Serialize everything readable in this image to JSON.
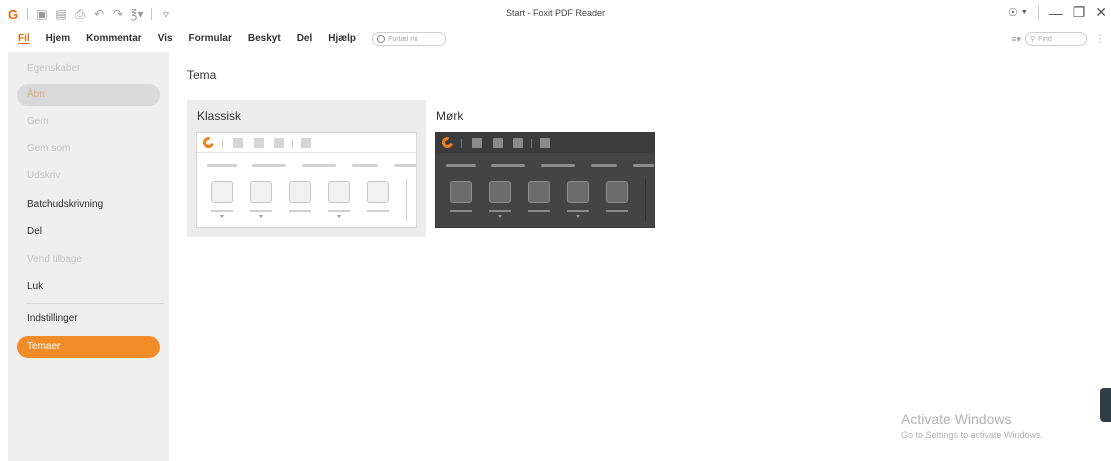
{
  "window": {
    "title": "Start - Foxit PDF Reader"
  },
  "colors": {
    "accent": "#f28c28",
    "brand": "#e8680b",
    "sidebar_bg": "#efefef",
    "dark_preview": "#444444"
  },
  "quick_access": [
    "foxit-logo-icon",
    "open-icon",
    "save-icon",
    "print-icon",
    "undo-icon",
    "redo-icon",
    "hand-icon",
    "customize-icon"
  ],
  "menu": {
    "items": [
      "Fil",
      "Hjem",
      "Kommentar",
      "Vis",
      "Formular",
      "Beskyt",
      "Del",
      "Hjælp"
    ],
    "tell_me_placeholder": "Fortæl mi",
    "find_placeholder": "Find"
  },
  "sidebar": {
    "items": [
      {
        "label": "Egenskaber",
        "state": "disabled"
      },
      {
        "label": "Åbn",
        "state": "hover"
      },
      {
        "label": "Gem",
        "state": "disabled"
      },
      {
        "label": "Gem som",
        "state": "disabled"
      },
      {
        "label": "Udskriv",
        "state": "disabled"
      },
      {
        "label": "Batchudskrivning",
        "state": "normal"
      },
      {
        "label": "Del",
        "state": "normal"
      },
      {
        "label": "Vend tilbage",
        "state": "disabled"
      },
      {
        "label": "Luk",
        "state": "normal"
      },
      {
        "label": "Indstillinger",
        "state": "normal"
      },
      {
        "label": "Temaer",
        "state": "selected"
      }
    ]
  },
  "main": {
    "section_title": "Tema",
    "themes": [
      {
        "label": "Klassisk",
        "selected": true
      },
      {
        "label": "Mørk",
        "selected": false
      }
    ]
  },
  "watermark": {
    "line1": "Activate Windows",
    "line2": "Go to Settings to activate Windows."
  }
}
